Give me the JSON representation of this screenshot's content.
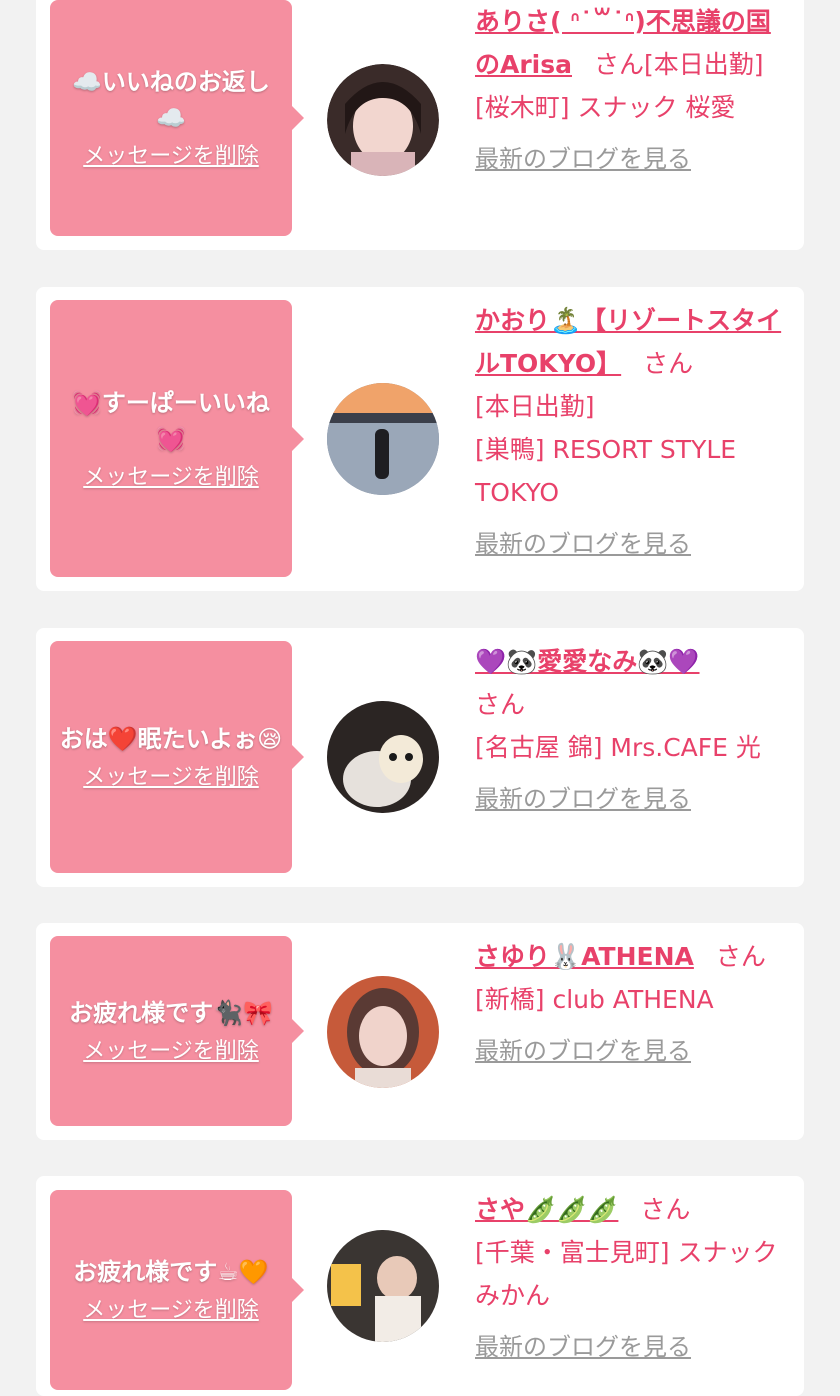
{
  "delete_label": "メッセージを削除",
  "blog_label": "最新のブログを見る",
  "accent_color": "#e8416a",
  "bubble_color": "#f58fa0",
  "cards": [
    {
      "message": "☁️いいねのお返し☁️",
      "name": "ありさ( ᐢ˙꒳˙ᐢ)不思議の国のArisa",
      "san": "さん",
      "status": "[本日出勤]",
      "shop": "[桜木町] スナック 桜愛"
    },
    {
      "message": "💓すーぱーいいね💓",
      "name": "かおり🏝️【リゾートスタイルTOKYO】",
      "san": "さん",
      "status": "[本日出勤]",
      "shop": "[巣鴨] RESORT STYLE TOKYO"
    },
    {
      "message": "おは❤️眠たいよぉ😪",
      "name": "💜🐼愛愛なみ🐼💜",
      "san": "さん",
      "status": "",
      "shop": "[名古屋 錦] Mrs.CAFE 光"
    },
    {
      "message": "お疲れ様です🐈‍⬛🎀",
      "name": "さゆり🐰ATHENA",
      "san": "さん",
      "status": "",
      "shop": "[新橋] club ATHENA"
    },
    {
      "message": "お疲れ様です☕🧡",
      "name": "さや🫛🫛🫛",
      "san": "さん",
      "status": "",
      "shop": "[千葉・富士見町] スナックみかん"
    }
  ]
}
